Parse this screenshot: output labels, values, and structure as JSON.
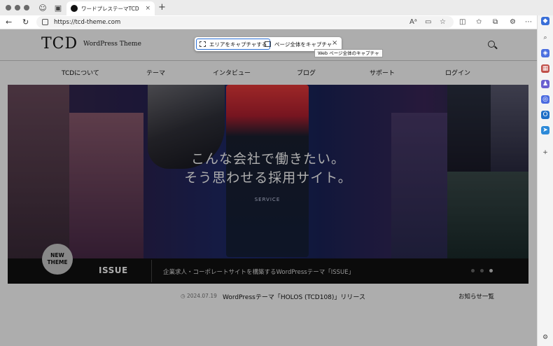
{
  "browser": {
    "tab_title": "ワードプレステーマTCD",
    "tab_close": "×",
    "new_tab": "+",
    "url": "https://tcd-theme.com"
  },
  "capture": {
    "area_label": "エリアをキャプチャする",
    "full_label": "ページ全体をキャプチャ",
    "close": "×",
    "tooltip": "Web ページ全体のキャプチャ"
  },
  "site": {
    "logo": "TCD",
    "logo_sub": "WordPress Theme",
    "nav": [
      "TCDについて",
      "テーマ",
      "インタビュー",
      "ブログ",
      "サポート",
      "ログイン"
    ]
  },
  "hero": {
    "headline_1": "こんな会社で働きたい。",
    "headline_2": "そう思わせる採用サイト。",
    "badge_1": "NEW",
    "badge_2": "THEME",
    "theme_name": "ISSUE",
    "description": "企業求人・コーポレートサイトを構築するWordPressテーマ「ISSUE」",
    "mock_service": "SERVICE",
    "slides_total": 3,
    "slide_active": 3
  },
  "news": {
    "date": "2024.07.19",
    "title": "WordPressテーマ「HOLOS (TCD108)」リリース",
    "more": "お知らせ一覧"
  },
  "colors": {
    "accent": "#2a6fd6",
    "hero_bar": "#111111"
  }
}
